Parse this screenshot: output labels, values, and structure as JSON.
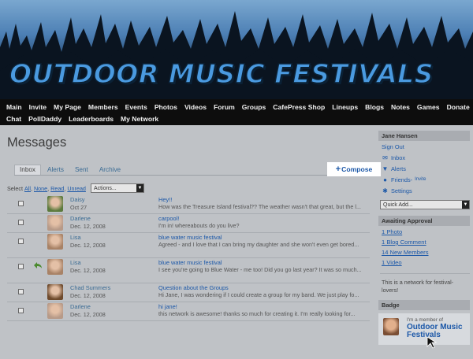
{
  "site": {
    "title": "OUTDOOR MUSIC FESTIVALS"
  },
  "nav": {
    "row1": [
      "Main",
      "Invite",
      "My Page",
      "Members",
      "Events",
      "Photos",
      "Videos",
      "Forum",
      "Groups",
      "CafePress Shop",
      "Lineups",
      "Blogs",
      "Notes",
      "Games",
      "Donate"
    ],
    "row2": [
      "Chat",
      "PollDaddy",
      "Leaderboards",
      "My Network"
    ]
  },
  "page": {
    "title": "Messages"
  },
  "tabs": [
    "Inbox",
    "Alerts",
    "Sent",
    "Archive"
  ],
  "compose": {
    "label": "Compose",
    "icon": "plus-icon"
  },
  "select": {
    "prefix": "Select",
    "all": "All",
    "none": "None",
    "read": "Read",
    "unread": "Unread",
    "actions": "Actions..."
  },
  "messages": [
    {
      "sender": "Daisy",
      "date": "Oct 27",
      "subject": "Hey!!",
      "preview": "How was the Treasure Island festival?? The weather wasn't that great, but the l...",
      "replied": false,
      "avatar_color": "#5c7a3c"
    },
    {
      "sender": "Darlene",
      "date": "Dec. 12, 2008",
      "subject": "carpool!",
      "preview": "I'm in! whereabouts do you live?",
      "replied": false,
      "avatar_color": "#b79a88"
    },
    {
      "sender": "Lisa",
      "date": "Dec. 12, 2008",
      "subject": "blue water music festival",
      "preview": "Agreed - and I love that I can bring my daughter and she won't even get bored...",
      "replied": false,
      "avatar_color": "#a88266"
    },
    {
      "sender": "Lisa",
      "date": "Dec. 12, 2008",
      "subject": "blue water music festival",
      "preview": "I see you're going to Blue Water - me too! Did you go last year? It was so much...",
      "replied": true,
      "avatar_color": "#a88266"
    },
    {
      "sender": "Chad Summers",
      "date": "Dec. 12, 2008",
      "subject": "Question about the Groups",
      "preview": "Hi Jane, I was wondering if I could create a group for my band. We just play fo...",
      "replied": false,
      "avatar_color": "#6e4a2c"
    },
    {
      "sender": "Darlene",
      "date": "Dec. 12, 2008",
      "subject": "hi jane!",
      "preview": "this network is awesome! thanks so much for creating it. I'm really looking for...",
      "replied": false,
      "avatar_color": "#b79a88"
    }
  ],
  "sidebar": {
    "user": "Jane Hansen",
    "sign_out": "Sign Out",
    "links": [
      {
        "label": "Inbox",
        "icon": "envelope-icon"
      },
      {
        "label": "Alerts",
        "icon": "alert-icon"
      },
      {
        "label": "Friends",
        "icon": "person-icon",
        "extra": "Invite"
      },
      {
        "label": "Settings",
        "icon": "gear-icon"
      }
    ],
    "friends_sep": " -",
    "quick_add": "Quick Add...",
    "approval": {
      "title": "Awaiting Approval",
      "items": [
        "1 Photo",
        "1 Blog Comment",
        "14 New Members",
        "1 Video"
      ]
    },
    "network_text": "This is a network for festival-lovers!",
    "badge": {
      "title": "Badge",
      "member_text": "I'm a member of",
      "name": "Outdoor Music Festivals"
    }
  },
  "colors": {
    "link": "#1c58a8",
    "nav_bg": "#0d0d0d",
    "title_blue": "#4a9ae0"
  }
}
